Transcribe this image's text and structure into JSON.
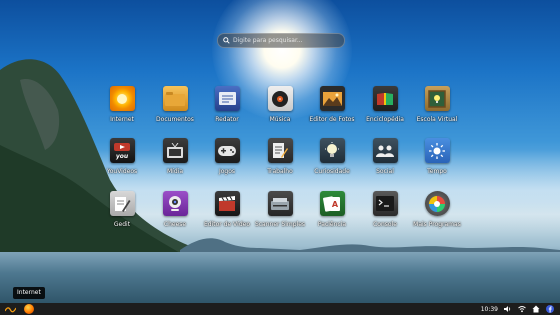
{
  "search": {
    "placeholder": "Digite para pesquisar..."
  },
  "apps": [
    {
      "label": "Internet",
      "icon": "sun-browser-icon"
    },
    {
      "label": "Documentos",
      "icon": "folder-icon"
    },
    {
      "label": "Redator",
      "icon": "text-editor-icon"
    },
    {
      "label": "Música",
      "icon": "vinyl-record-icon"
    },
    {
      "label": "Editor de Fotos",
      "icon": "photo-editor-icon"
    },
    {
      "label": "Enciclopédia",
      "icon": "book-icon"
    },
    {
      "label": "Escola Virtual",
      "icon": "bulb-board-icon"
    },
    {
      "label": "YouVideos",
      "icon": "youvideos-icon"
    },
    {
      "label": "Mídia",
      "icon": "tv-icon"
    },
    {
      "label": "Jogos",
      "icon": "gamepad-icon"
    },
    {
      "label": "Trabalho",
      "icon": "document-pen-icon"
    },
    {
      "label": "Curiosidade",
      "icon": "lightbulb-icon"
    },
    {
      "label": "Social",
      "icon": "people-icon"
    },
    {
      "label": "Tempo",
      "icon": "weather-icon"
    },
    {
      "label": "Gedit",
      "icon": "pen-paper-icon"
    },
    {
      "label": "Cheese",
      "icon": "webcam-icon"
    },
    {
      "label": "Editor de Vídeo",
      "icon": "clapperboard-icon"
    },
    {
      "label": "Scanner Simples",
      "icon": "scanner-icon"
    },
    {
      "label": "Paciência",
      "icon": "playing-cards-icon"
    },
    {
      "label": "Console",
      "icon": "terminal-icon"
    },
    {
      "label": "Mais Programas",
      "icon": "app-grid-icon"
    }
  ],
  "tooltip": {
    "text": "Internet"
  },
  "taskbar": {
    "clock": "10:39",
    "tray_icons": [
      "volume-icon",
      "wifi-icon",
      "home-icon",
      "facebook-icon"
    ]
  },
  "colors": {
    "panel": "#1d1d1d",
    "accent": "#ff7a00"
  }
}
